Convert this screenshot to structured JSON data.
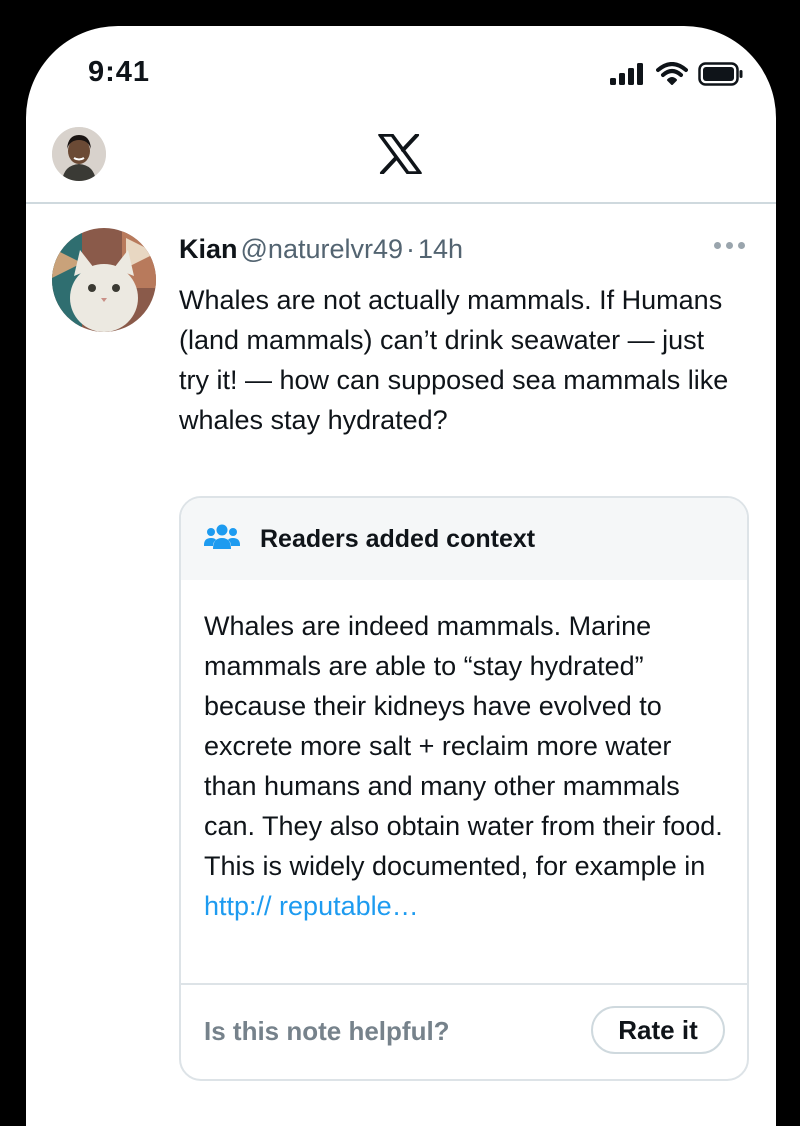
{
  "status_bar": {
    "time": "9:41",
    "icons": [
      "signal-icon",
      "wifi-icon",
      "battery-icon"
    ]
  },
  "header": {
    "logo": "x-logo-icon"
  },
  "tweet": {
    "name": "Kian",
    "handle": "@naturelvr49",
    "separator": "·",
    "time": "14h",
    "text": "Whales are not actually mammals. If Humans (land mammals) can’t drink seawater — just try it! — how can supposed sea mammals like whales stay hydrated?"
  },
  "note": {
    "title": "Readers added context",
    "body": "Whales are indeed mammals. Marine mammals are able to “stay hydrated” because their kidneys have evolved to excrete more salt + reclaim more water than humans and many other mammals can. They also obtain water from their food. This is widely documented, for example in ",
    "link": "http:// reputable…",
    "question": "Is this note helpful?",
    "rate_label": "Rate it"
  },
  "colors": {
    "link": "#1d9bf0",
    "text": "#0f1419",
    "secondary": "#536471",
    "note_icon": "#1d9bf0"
  }
}
